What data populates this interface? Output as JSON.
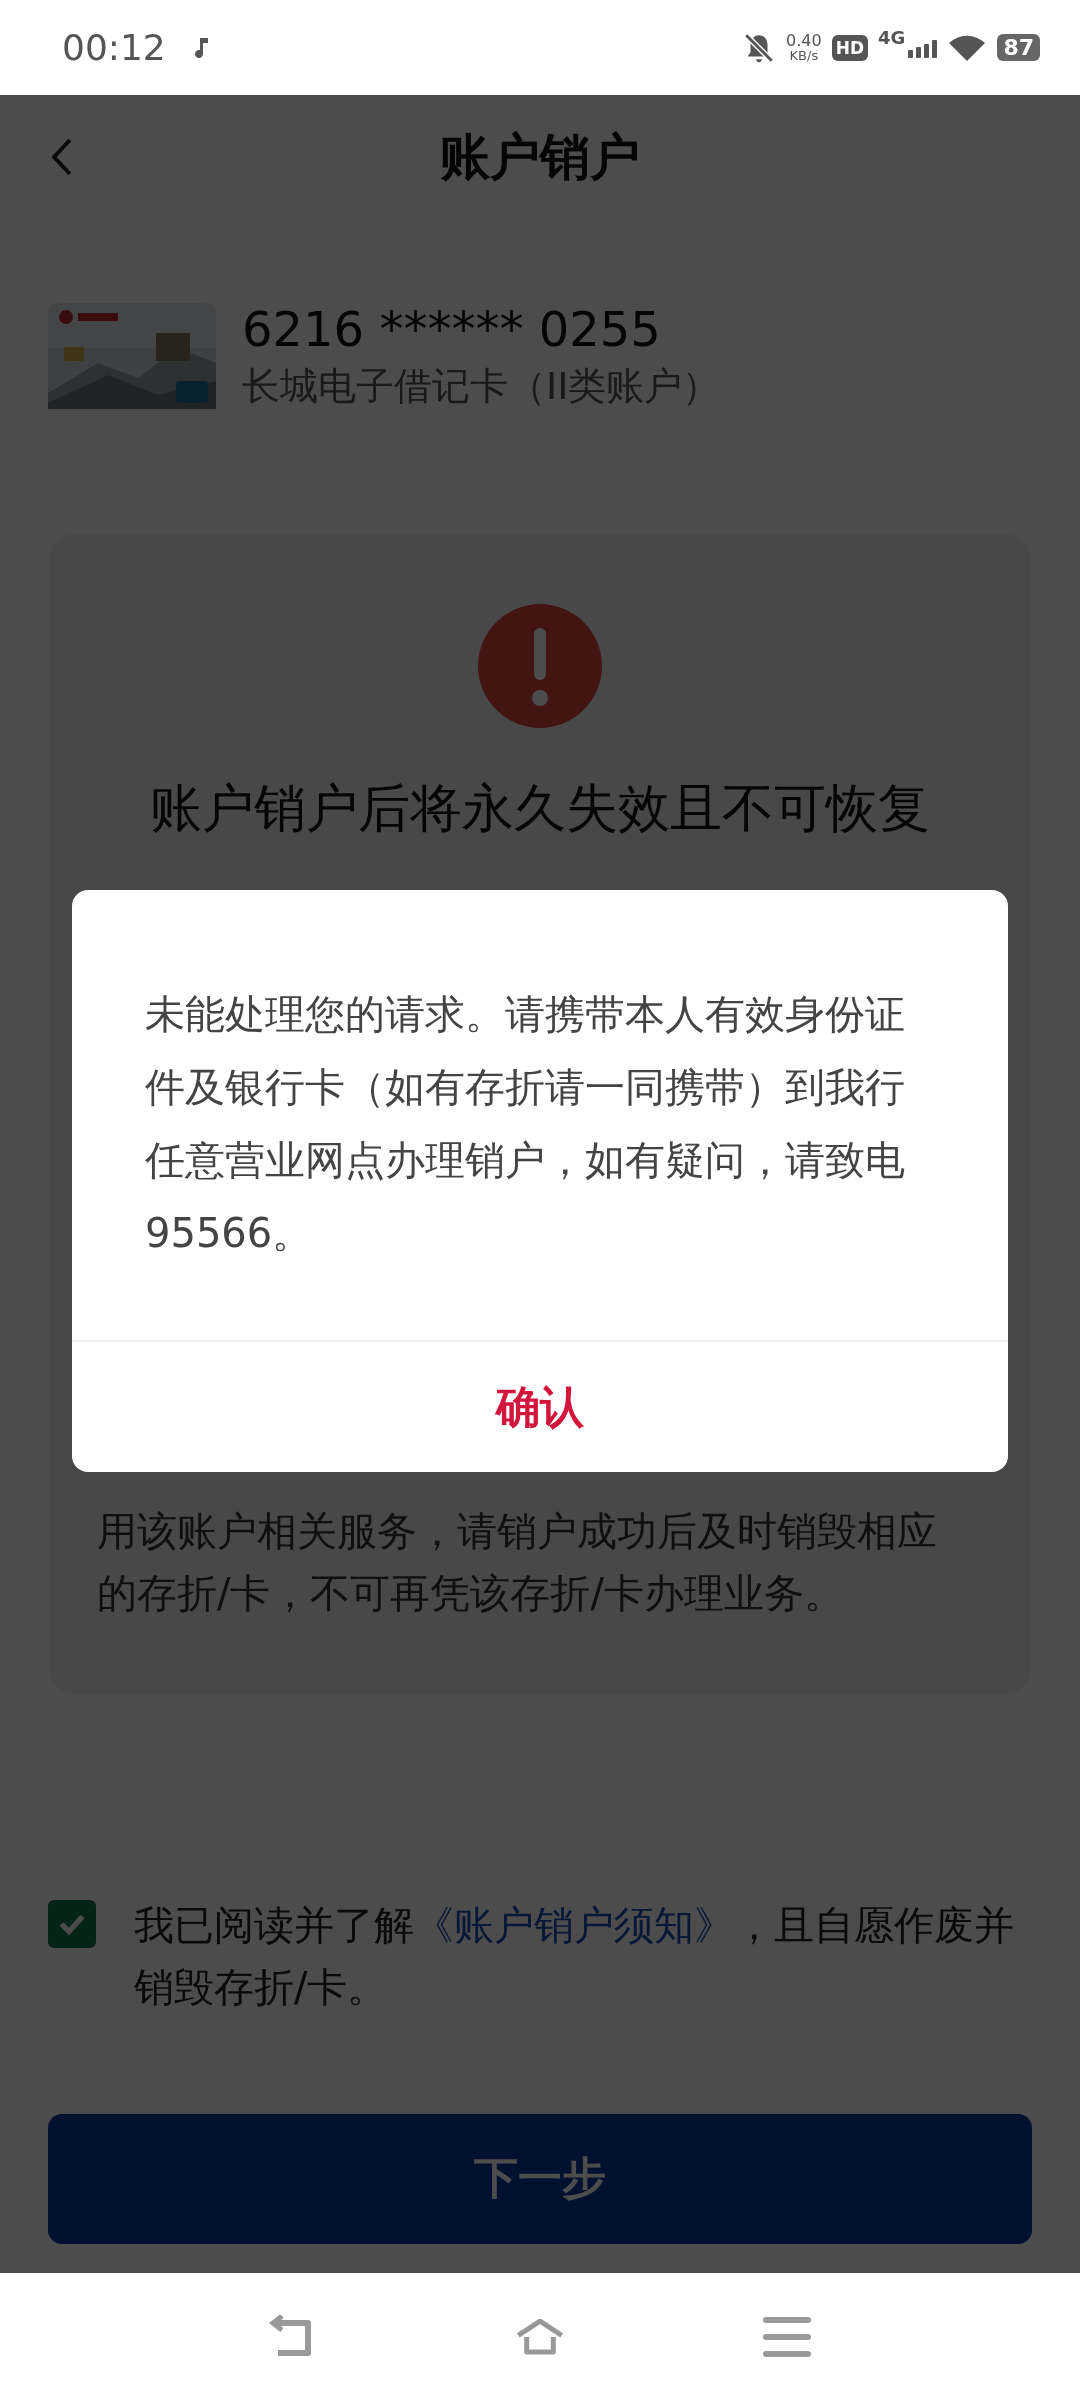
{
  "status_bar": {
    "time": "00:12",
    "speed_value": "0.40",
    "speed_unit": "KB/s",
    "hd": "HD",
    "network": "4G",
    "battery": "87"
  },
  "header": {
    "title": "账户销户"
  },
  "account": {
    "number": "6216 ****** 0255",
    "type": "长城电子借记卡（II类账户）"
  },
  "warning": {
    "title": "账户销户后将永久失效且不可恢复"
  },
  "notice_lines": [
    "用该账户相关服务，请销户成功后及时销毁相应",
    "的存折/卡，不可再凭该存折/卡办理业务。"
  ],
  "agreement": {
    "checked": true,
    "before": "我已阅读并了解",
    "link": "《账户销户须知》",
    "after": "，且自愿作废并销毁存折/卡。"
  },
  "next_button": {
    "label": "下一步"
  },
  "dialog": {
    "message": "未能处理您的请求。请携带本人有效身份证件及银行卡（如有存折请一同携带）到我行任意营业网点办理销户，如有疑问，请致电95566。",
    "confirm": "确认"
  }
}
